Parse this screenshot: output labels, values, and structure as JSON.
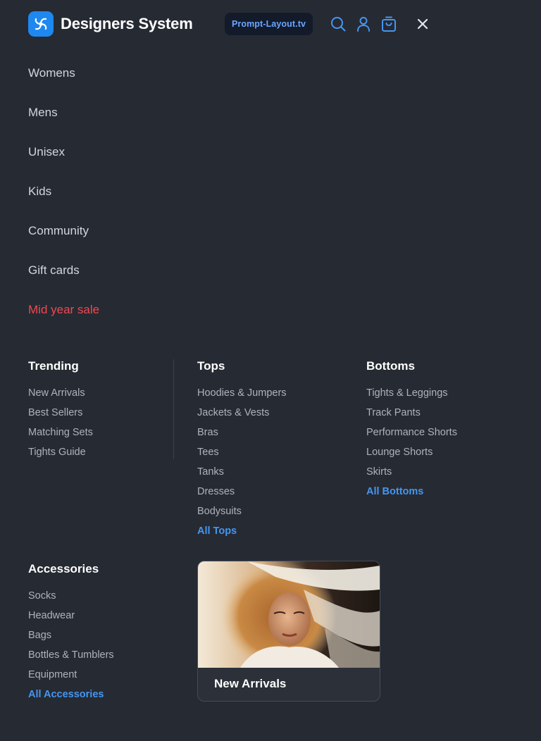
{
  "header": {
    "brand": "Designers System",
    "badge": "Prompt-Layout.tv",
    "icons": [
      "search-icon",
      "user-icon",
      "shopping-bag-icon",
      "close-icon"
    ],
    "accent": "#1e88f0"
  },
  "main_nav": [
    {
      "label": "Womens"
    },
    {
      "label": "Mens"
    },
    {
      "label": "Unisex"
    },
    {
      "label": "Kids"
    },
    {
      "label": "Community"
    },
    {
      "label": "Gift cards"
    },
    {
      "label": "Mid year sale",
      "highlight_color": "#f0484f"
    }
  ],
  "columns": {
    "trending": {
      "title": "Trending",
      "links": [
        "New Arrivals",
        "Best Sellers",
        "Matching Sets",
        "Tights Guide"
      ]
    },
    "tops": {
      "title": "Tops",
      "links": [
        "Hoodies & Jumpers",
        "Jackets & Vests",
        "Bras",
        "Tees",
        "Tanks",
        "Dresses",
        "Bodysuits"
      ],
      "all_label": "All Tops"
    },
    "bottoms": {
      "title": "Bottoms",
      "links": [
        "Tights & Leggings",
        "Track Pants",
        "Performance Shorts",
        "Lounge Shorts",
        "Skirts"
      ],
      "all_label": "All Bottoms"
    },
    "accessories": {
      "title": "Accessories",
      "links": [
        "Socks",
        "Headwear",
        "Bags",
        "Bottles & Tumblers",
        "Equipment"
      ],
      "all_label": "All Accessories"
    }
  },
  "promo": {
    "label": "New Arrivals"
  },
  "colors": {
    "background": "#262a33",
    "link_accent": "#4596f0",
    "sale": "#f0484f"
  }
}
